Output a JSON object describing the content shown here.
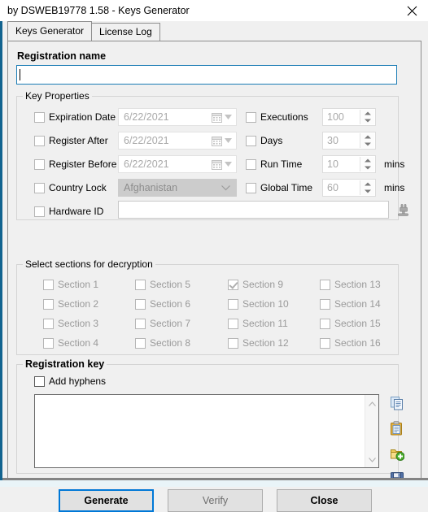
{
  "window": {
    "title": "by DSWEB19778 1.58 - Keys Generator",
    "close_icon": "close-icon"
  },
  "tabs": [
    {
      "label": "Keys Generator",
      "active": true
    },
    {
      "label": "License Log",
      "active": false
    }
  ],
  "registration_name": {
    "label": "Registration name",
    "value": "",
    "focused": true
  },
  "key_properties": {
    "title": "Key Properties",
    "left_rows": [
      {
        "label": "Expiration Date",
        "checked": false,
        "control": "date",
        "value": "6/22/2021",
        "enabled": false
      },
      {
        "label": "Register After",
        "checked": false,
        "control": "date",
        "value": "6/22/2021",
        "enabled": false
      },
      {
        "label": "Register Before",
        "checked": false,
        "control": "date",
        "value": "6/22/2021",
        "enabled": false
      },
      {
        "label": "Country Lock",
        "checked": false,
        "control": "combo",
        "value": "Afghanistan",
        "enabled": false
      },
      {
        "label": "Hardware ID",
        "checked": false,
        "control": "text",
        "value": "",
        "enabled": false
      }
    ],
    "right_rows": [
      {
        "label": "Executions",
        "checked": false,
        "value": "100",
        "unit": "",
        "enabled": false
      },
      {
        "label": "Days",
        "checked": false,
        "value": "30",
        "unit": "",
        "enabled": false
      },
      {
        "label": "Run Time",
        "checked": false,
        "value": "10",
        "unit": "mins",
        "enabled": false
      },
      {
        "label": "Global Time",
        "checked": false,
        "value": "60",
        "unit": "mins",
        "enabled": false
      }
    ],
    "hardware_id_icon": "plug-icon"
  },
  "sections": {
    "title": "Select sections for decryption",
    "items": [
      {
        "label": "Section 1",
        "checked": false
      },
      {
        "label": "Section 5",
        "checked": false
      },
      {
        "label": "Section 9",
        "checked": true
      },
      {
        "label": "Section 13",
        "checked": false
      },
      {
        "label": "Section 2",
        "checked": false
      },
      {
        "label": "Section 6",
        "checked": false
      },
      {
        "label": "Section 10",
        "checked": false
      },
      {
        "label": "Section 14",
        "checked": false
      },
      {
        "label": "Section 3",
        "checked": false
      },
      {
        "label": "Section 7",
        "checked": false
      },
      {
        "label": "Section 11",
        "checked": false
      },
      {
        "label": "Section 15",
        "checked": false
      },
      {
        "label": "Section 4",
        "checked": false
      },
      {
        "label": "Section 8",
        "checked": false
      },
      {
        "label": "Section 12",
        "checked": false
      },
      {
        "label": "Section 16",
        "checked": false
      }
    ]
  },
  "registration_key": {
    "title": "Registration key",
    "add_hyphens": {
      "label": "Add hyphens",
      "checked": false
    },
    "value": "",
    "side_icons": [
      {
        "name": "copy-icon"
      },
      {
        "name": "paste-icon"
      },
      {
        "name": "add-license-icon"
      },
      {
        "name": "save-icon"
      }
    ],
    "scroll_up_icon": "chevron-up-icon",
    "scroll_down_icon": "chevron-down-icon"
  },
  "buttons": [
    {
      "label": "Generate",
      "state": "focused"
    },
    {
      "label": "Verify",
      "state": "disabled"
    },
    {
      "label": "Close",
      "state": "normal"
    }
  ],
  "colors": {
    "accent": "#0078d7",
    "left_strip": "#12638f",
    "bottom_strip": "#e9f4f8",
    "face": "#f0f0f0"
  }
}
